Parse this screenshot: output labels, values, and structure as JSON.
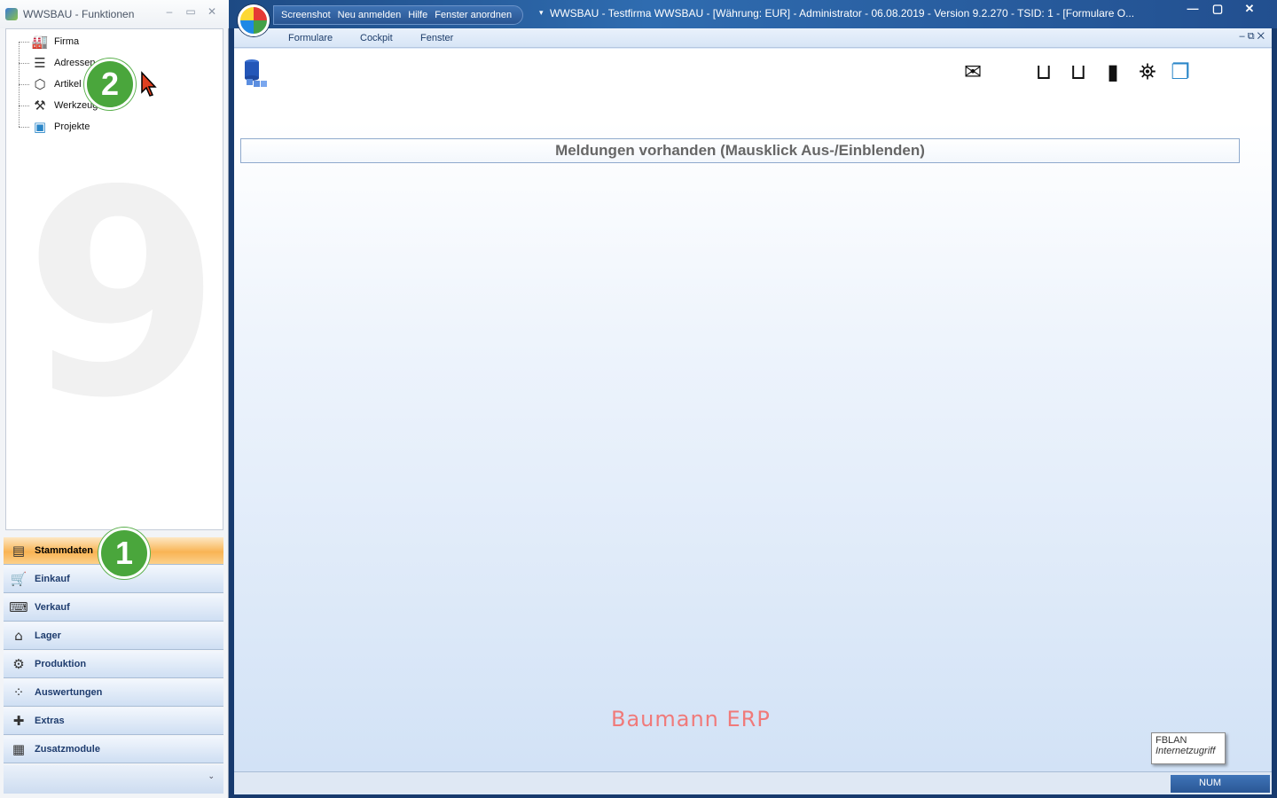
{
  "left_window": {
    "title": "WWSBAU - Funktionen",
    "controls": {
      "minimize": "–",
      "maximize": "▭",
      "close": "✕"
    },
    "tree": [
      {
        "label": "Firma",
        "icon": "factory-icon",
        "glyph": "🏭"
      },
      {
        "label": "Adressen",
        "icon": "address-card-icon",
        "glyph": "☰"
      },
      {
        "label": "Artikel",
        "icon": "box-icon",
        "glyph": "⬡"
      },
      {
        "label": "Werkzeuge",
        "icon": "tools-icon",
        "glyph": "⚒"
      },
      {
        "label": "Projekte",
        "icon": "project-icon",
        "glyph": "▣"
      }
    ],
    "watermark": "9",
    "nav": [
      {
        "label": "Stammdaten",
        "icon": "master-data-icon",
        "glyph": "▤",
        "active": true
      },
      {
        "label": "Einkauf",
        "icon": "shopping-cart-icon",
        "glyph": "🛒"
      },
      {
        "label": "Verkauf",
        "icon": "cash-register-icon",
        "glyph": "⌨"
      },
      {
        "label": "Lager",
        "icon": "warehouse-icon",
        "glyph": "⌂"
      },
      {
        "label": "Produktion",
        "icon": "production-icon",
        "glyph": "⚙"
      },
      {
        "label": "Auswertungen",
        "icon": "analytics-icon",
        "glyph": "⁘"
      },
      {
        "label": "Extras",
        "icon": "extras-icon",
        "glyph": "✚"
      },
      {
        "label": "Zusatzmodule",
        "icon": "modules-icon",
        "glyph": "▦"
      }
    ],
    "nav_footer_glyph": "⌄"
  },
  "badges": {
    "one": "1",
    "two": "2"
  },
  "right_window": {
    "qat": [
      "Screenshot",
      "Neu anmelden",
      "Hilfe",
      "Fenster anordnen"
    ],
    "title": "WWSBAU - Testfirma WWSBAU - [Währung: EUR] - Administrator - 06.08.2019 - Version 9.2.270 - TSID: 1 - [Formulare O...",
    "controls": {
      "minimize": "—",
      "maximize": "▢",
      "close": "✕"
    },
    "menu": [
      "Formulare",
      "Cockpit",
      "Fenster"
    ],
    "mdi_controls": "–  ⧉  ✕",
    "toolbar_icons": [
      {
        "name": "mail-icon",
        "glyph": "✉"
      },
      {
        "name": "mouse-left-icon",
        "glyph": "⊔"
      },
      {
        "name": "mouse-right-icon",
        "glyph": "⊔"
      },
      {
        "name": "device-icon",
        "glyph": "▮"
      },
      {
        "name": "network-user-icon",
        "glyph": "⛯"
      },
      {
        "name": "documents-icon",
        "glyph": "❐"
      }
    ],
    "message_bar": "Meldungen vorhanden  (Mausklick Aus-/Einblenden)",
    "brand": "Baumann ERP",
    "tooltip": {
      "line1": "FBLAN",
      "line2": "Internetzugriff"
    },
    "status": {
      "num": "NUM"
    }
  },
  "colors": {
    "accent": "#4aa63c",
    "active_nav": "#f9b454",
    "brand_text": "#f07a7a"
  }
}
